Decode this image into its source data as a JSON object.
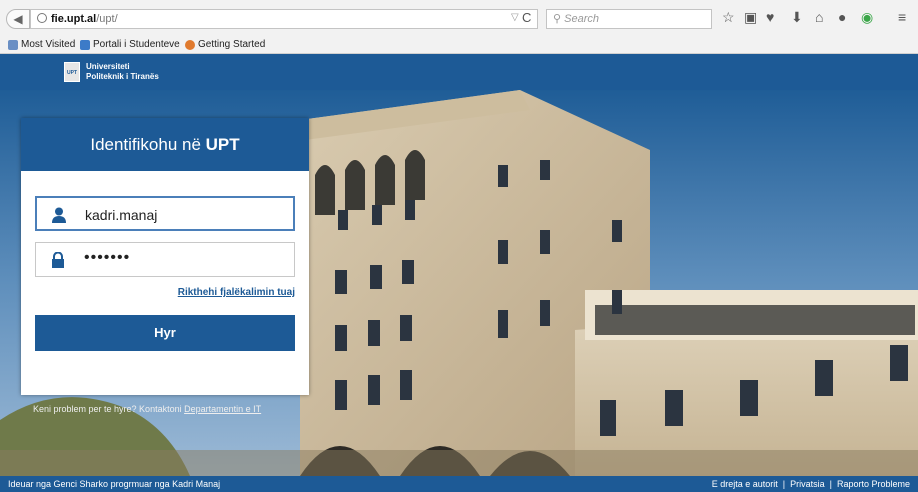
{
  "browser": {
    "url_host": "fie.upt.al",
    "url_path": "/upt/",
    "search_placeholder": "Search",
    "bookmarks": [
      {
        "label": "Most Visited"
      },
      {
        "label": "Portali i Studenteve"
      },
      {
        "label": "Getting Started"
      }
    ]
  },
  "header": {
    "logo_text_line1": "Universiteti",
    "logo_text_line2": "Politeknik i Tiranës",
    "logo_badge": "UPT"
  },
  "login": {
    "title_prefix": "Identifikohu në ",
    "title_bold": "UPT",
    "username": "kadri.manaj",
    "password_mask": "•••••••",
    "reset_link": "Rikthehi fjalëkalimin tuaj",
    "submit": "Hyr"
  },
  "problem": {
    "text": "Keni problem per te hyre? Kontaktoni ",
    "link": "Departamentin e IT"
  },
  "footer": {
    "left": "Ideuar nga Genci Sharko progrmuar nga Kadri Manaj",
    "right": "E drejta e autorit  |  Privatsia  |  Raporto Probleme"
  },
  "colors": {
    "brand": "#1d5a96"
  }
}
